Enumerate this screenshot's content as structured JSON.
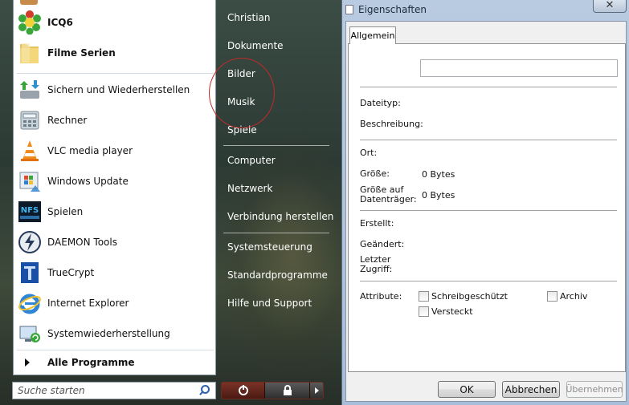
{
  "start_menu": {
    "pinned": [
      {
        "label": "ICQ6",
        "icon": "icq-flower-icon"
      },
      {
        "label": "Filme Serien",
        "icon": "folder-icon"
      }
    ],
    "recent": [
      {
        "label": "Sichern und Wiederherstellen",
        "icon": "backup-restore-icon"
      },
      {
        "label": "Rechner",
        "icon": "calculator-icon"
      },
      {
        "label": "VLC media player",
        "icon": "vlc-cone-icon"
      },
      {
        "label": "Windows Update",
        "icon": "windows-update-icon"
      },
      {
        "label": "Spielen",
        "icon": "nfs-game-icon"
      },
      {
        "label": "DAEMON Tools",
        "icon": "daemon-tools-icon"
      },
      {
        "label": "TrueCrypt",
        "icon": "truecrypt-icon"
      },
      {
        "label": "Internet Explorer",
        "icon": "internet-explorer-icon"
      },
      {
        "label": "Systemwiederherstellung",
        "icon": "system-restore-icon"
      }
    ],
    "all_programs": "Alle Programme",
    "search_placeholder": "Suche starten",
    "right": {
      "user": "Christian",
      "documents": "Dokumente",
      "pictures": "Bilder",
      "music": "Musik",
      "games": "Spiele",
      "computer": "Computer",
      "network": "Netzwerk",
      "connect": "Verbindung herstellen",
      "control_panel": "Systemsteuerung",
      "default_programs": "Standardprogramme",
      "help": "Hilfe und Support"
    },
    "accent_color": "#c02b2b"
  },
  "dialog": {
    "title": "Eigenschaften",
    "close_glyph": "✕",
    "tab": "Allgemein",
    "name_value": "",
    "labels": {
      "type": "Dateityp:",
      "description": "Beschreibung:",
      "location": "Ort:",
      "size": "Größe:",
      "size_on_disk_1": "Größe auf",
      "size_on_disk_2": "Datenträger:",
      "created": "Erstellt:",
      "modified": "Geändert:",
      "accessed_1": "Letzter",
      "accessed_2": "Zugriff:",
      "attributes": "Attribute:"
    },
    "values": {
      "size": "0 Bytes",
      "size_on_disk": "0 Bytes"
    },
    "attributes": {
      "readonly": "Schreibgeschützt",
      "hidden": "Versteckt",
      "archive": "Archiv"
    },
    "buttons": {
      "ok": "OK",
      "cancel": "Abbrechen",
      "apply": "Übernehmen"
    }
  }
}
